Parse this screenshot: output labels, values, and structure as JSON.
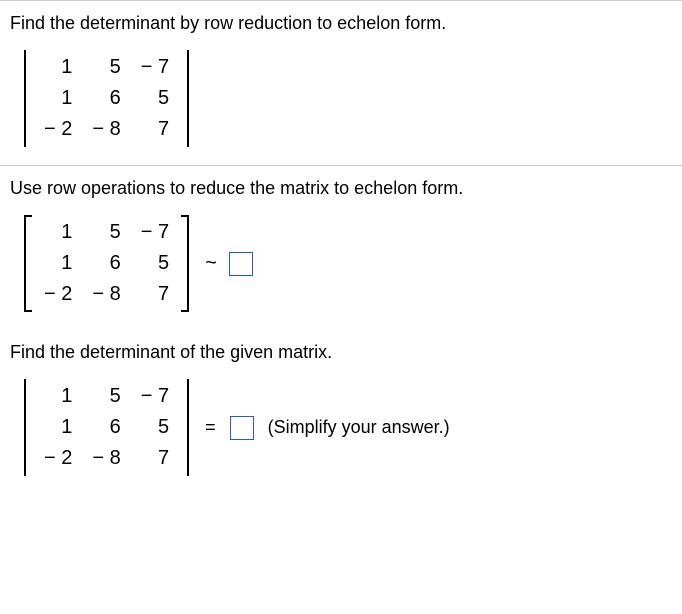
{
  "section1": {
    "prompt": "Find the determinant by row reduction to echelon form.",
    "matrix": [
      [
        "1",
        "5",
        "− 7"
      ],
      [
        "1",
        "6",
        "5"
      ],
      [
        "− 2",
        "− 8",
        "7"
      ]
    ]
  },
  "section2": {
    "prompt": "Use row operations to reduce the matrix to echelon form.",
    "matrix": [
      [
        "1",
        "5",
        "− 7"
      ],
      [
        "1",
        "6",
        "5"
      ],
      [
        "− 2",
        "− 8",
        "7"
      ]
    ],
    "tilde": "~"
  },
  "section3": {
    "prompt": "Find the determinant of the given matrix.",
    "matrix": [
      [
        "1",
        "5",
        "− 7"
      ],
      [
        "1",
        "6",
        "5"
      ],
      [
        "− 2",
        "− 8",
        "7"
      ]
    ],
    "eq": "=",
    "hint": "(Simplify your answer.)"
  }
}
